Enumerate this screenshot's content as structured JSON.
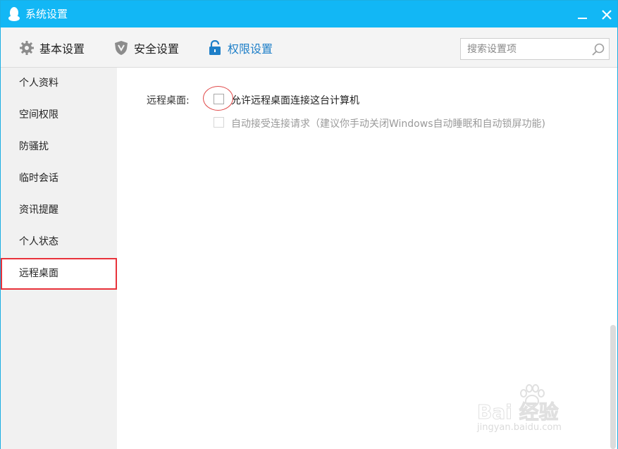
{
  "window": {
    "title": "系统设置"
  },
  "toolbar": {
    "tabs": [
      {
        "label": "基本设置",
        "icon": "gear-icon"
      },
      {
        "label": "安全设置",
        "icon": "shield-icon"
      },
      {
        "label": "权限设置",
        "icon": "lock-icon",
        "active": true
      }
    ],
    "search_placeholder": "搜索设置项"
  },
  "sidebar": {
    "items": [
      {
        "label": "个人资料"
      },
      {
        "label": "空间权限"
      },
      {
        "label": "防骚扰"
      },
      {
        "label": "临时会话"
      },
      {
        "label": "资讯提醒"
      },
      {
        "label": "个人状态"
      },
      {
        "label": "远程桌面",
        "selected": true
      }
    ]
  },
  "content": {
    "section_label": "远程桌面:",
    "options": [
      {
        "label": "允许远程桌面连接这台计算机",
        "checked": false,
        "enabled": true
      },
      {
        "label": "自动接受连接请求（建议你手动关闭Windows自动睡眠和自动锁屏功能)",
        "checked": false,
        "enabled": false
      }
    ]
  },
  "watermark": {
    "text": "Bai 经验",
    "url": "jingyan.baidu.com"
  },
  "colors": {
    "titlebar": "#12b7f5",
    "accent": "#1e7fc8",
    "highlight": "#e8323a"
  }
}
